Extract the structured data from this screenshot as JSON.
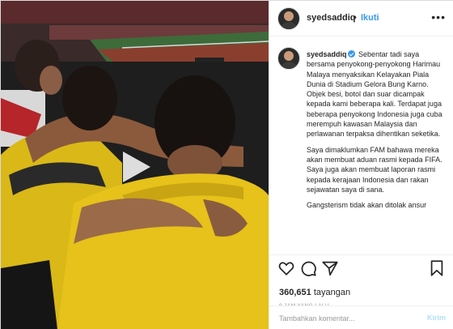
{
  "post": {
    "username": "syedsaddiq",
    "follow_label": "Ikuti",
    "separator": "•",
    "more_label": "•••",
    "verified": true
  },
  "caption": {
    "username": "syedsaddiq",
    "paragraphs": [
      "Sebentar tadi saya bersama penyokong-penyokong Harimau Malaya menyaksikan Kelayakan Piala Dunia di Stadium Gelora Bung Karno. Objek besi, botol dan suar dicampak kepada kami beberapa kali. Terdapat juga beberapa penyokong Indonesia juga cuba merempuh kawasan Malaysia dan perlawanan terpaksa dihentikan seketika.",
      "Saya dimaklumkan FAM bahawa mereka akan membuat aduan rasmi kepada FIFA. Saya juga akan membuat laporan rasmi kepada kerajaan Indonesia dan rakan sejawatan saya di sana.",
      "Gangsterism tidak akan ditolak ansur"
    ]
  },
  "stats": {
    "views": "360,651",
    "views_label": "tayangan",
    "time": "9 JAM YANG LALU"
  },
  "comment_box": {
    "placeholder": "Tambahkan komentar...",
    "post_label": "Kirim"
  },
  "icons": {
    "like": "heart-icon",
    "comment": "comment-icon",
    "share": "share-icon",
    "save": "bookmark-icon",
    "play": "play-icon",
    "verified": "verified-badge-icon"
  },
  "colors": {
    "link_blue": "#3897f0",
    "post_disabled": "#b2dffc",
    "jersey_yellow": "#e6c21a"
  }
}
